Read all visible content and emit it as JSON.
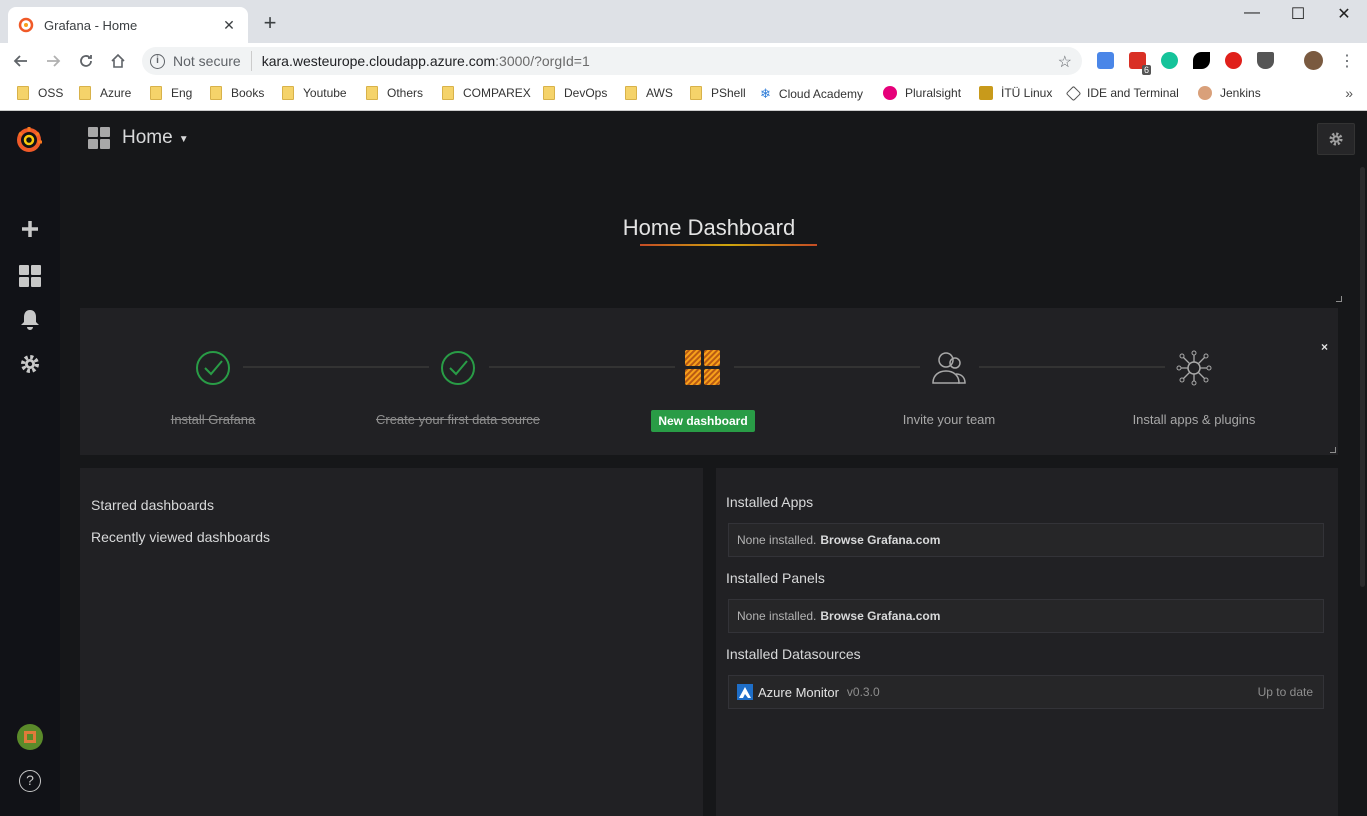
{
  "browser": {
    "tab_title": "Grafana - Home",
    "security_label": "Not secure",
    "url_host": "kara.westeurope.cloudapp.azure.com",
    "url_rest": ":3000/?orgId=1",
    "extension_badge": "6",
    "bookmarks": [
      {
        "label": "OSS",
        "type": "folder"
      },
      {
        "label": "Azure",
        "type": "folder"
      },
      {
        "label": "Eng",
        "type": "folder"
      },
      {
        "label": "Books",
        "type": "folder"
      },
      {
        "label": "Youtube",
        "type": "folder"
      },
      {
        "label": "Others",
        "type": "folder"
      },
      {
        "label": "COMPAREX",
        "type": "folder"
      },
      {
        "label": "DevOps",
        "type": "folder"
      },
      {
        "label": "AWS",
        "type": "folder"
      },
      {
        "label": "PShell",
        "type": "folder"
      },
      {
        "label": "Cloud Academy",
        "type": "site"
      },
      {
        "label": "Pluralsight",
        "type": "site"
      },
      {
        "label": "İTÜ Linux",
        "type": "site"
      },
      {
        "label": "IDE and Terminal",
        "type": "site"
      },
      {
        "label": "Jenkins",
        "type": "site"
      }
    ],
    "bookmarks_more": "»"
  },
  "grafana": {
    "dashboard_picker": "Home",
    "dashboard_title": "Home Dashboard",
    "getting_started": {
      "close": "×",
      "steps": [
        {
          "label": "Install Grafana",
          "state": "done"
        },
        {
          "label": "Create your first data source",
          "state": "done"
        },
        {
          "label": "New dashboard",
          "state": "active"
        },
        {
          "label": "Invite your team",
          "state": "todo"
        },
        {
          "label": "Install apps & plugins",
          "state": "todo"
        }
      ]
    },
    "starred": {
      "starred_label": "Starred dashboards",
      "recent_label": "Recently viewed dashboards"
    },
    "plugins": {
      "apps_title": "Installed Apps",
      "apps_empty": "None installed.",
      "apps_browse": "Browse Grafana.com",
      "panels_title": "Installed Panels",
      "panels_empty": "None installed.",
      "panels_browse": "Browse Grafana.com",
      "datasources_title": "Installed Datasources",
      "datasource_name": "Azure Monitor",
      "datasource_version": "v0.3.0",
      "datasource_status": "Up to date"
    },
    "help": "?"
  },
  "colors": {
    "grafana_bg": "#161719",
    "panel_bg": "#212124",
    "sidemenu_bg": "#111217",
    "success_green": "#299c46",
    "brand_orange": "#f05a28"
  }
}
